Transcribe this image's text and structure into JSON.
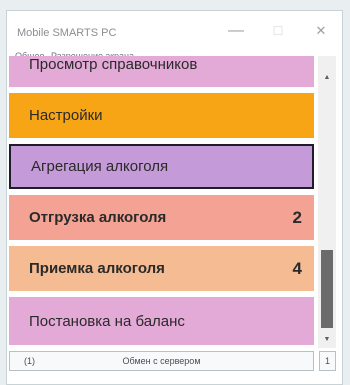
{
  "window": {
    "title": "Mobile SMARTS PC",
    "minimize_glyph": "—",
    "maximize_glyph": "☐",
    "close_glyph": "✕"
  },
  "menu": {
    "items": [
      "Общее",
      "Разрешение экрана..."
    ]
  },
  "tiles": [
    {
      "label": "Просмотр справочников",
      "count": "",
      "color": "#e3a9d7"
    },
    {
      "label": "Настройки",
      "count": "",
      "color": "#f7a514"
    },
    {
      "label": "Агрегация алкоголя",
      "count": "",
      "color": "#c49ad8"
    },
    {
      "label": "Отгрузка алкоголя",
      "count": "2",
      "color": "#f3a293"
    },
    {
      "label": "Приемка алкоголя",
      "count": "4",
      "color": "#f5bb92"
    },
    {
      "label": "Постановка на баланс",
      "count": "",
      "color": "#e3a9d7"
    }
  ],
  "scrollbar": {
    "up_glyph": "▲",
    "down_glyph": "▼"
  },
  "status": {
    "left": "(1)",
    "center": "Обмен с сервером",
    "right": "1"
  }
}
